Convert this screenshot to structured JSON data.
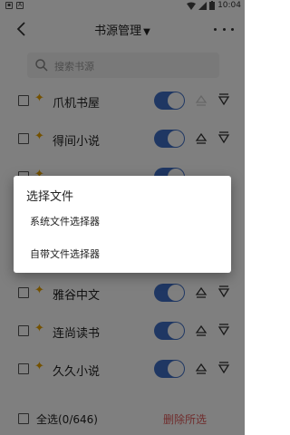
{
  "status_bar": {
    "time": "10:04"
  },
  "app_bar": {
    "title": "书源管理",
    "title_caret": "▼"
  },
  "search": {
    "placeholder": "搜索书源"
  },
  "sources": [
    {
      "name": "爪机书屋",
      "enabled": true
    },
    {
      "name": "得间小说",
      "enabled": true
    },
    {
      "name": "",
      "enabled": true
    },
    {
      "name": "",
      "enabled": true
    },
    {
      "name": "",
      "enabled": true
    },
    {
      "name": "雅谷中文",
      "enabled": true
    },
    {
      "name": "连尚读书",
      "enabled": true
    },
    {
      "name": "久久小说",
      "enabled": true
    }
  ],
  "bottom_bar": {
    "select_all": "全选(0/646)",
    "delete_selected": "删除所选"
  },
  "dialog": {
    "title": "选择文件",
    "options": [
      {
        "label": "系统文件选择器"
      },
      {
        "label": "自带文件选择器"
      }
    ]
  },
  "colors": {
    "toggle_on": "#3f6ec7",
    "delete_text": "#e05a5a",
    "spark": "#e8a300"
  }
}
